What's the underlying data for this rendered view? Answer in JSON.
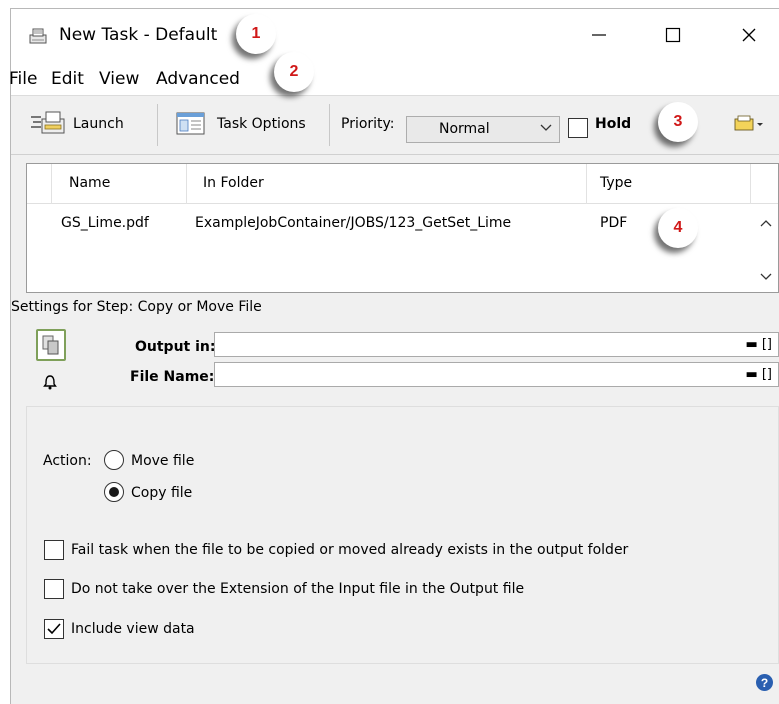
{
  "window": {
    "title": "New Task - Default",
    "minimize_glyph": "—",
    "maximize_glyph": "☐",
    "close_glyph": "✕"
  },
  "callouts": [
    "1",
    "2",
    "3",
    "4"
  ],
  "menu": [
    "File",
    "Edit",
    "View",
    "Advanced"
  ],
  "toolbar": {
    "launch_label": "Launch",
    "task_options_label": "Task Options",
    "priority_label": "Priority:",
    "priority_value": "Normal",
    "hold_label": "Hold",
    "hold_checked": false
  },
  "file_list": {
    "columns": [
      "Name",
      "In Folder",
      "Type"
    ],
    "rows": [
      {
        "name": "GS_Lime.pdf",
        "folder": "ExampleJobContainer/JOBS/123_GetSet_Lime",
        "type": "PDF"
      }
    ]
  },
  "settings": {
    "title": "Settings for Step: Copy or Move File",
    "output_in_label": "Output in:",
    "output_in_value": "",
    "file_name_label": "File Name:",
    "file_name_value": "",
    "field_btn_folder": "▬",
    "field_btn_brackets": "[]"
  },
  "panel": {
    "action_label": "Action:",
    "move_label": "Move file",
    "copy_label": "Copy file",
    "selected_action": "copy",
    "fail_label": "Fail task when the file to be copied or moved already exists in the output folder",
    "fail_checked": false,
    "extension_label": "Do not take over the Extension of the Input file in the Output file",
    "extension_checked": false,
    "include_view_label": "Include view data",
    "include_view_checked": true
  },
  "help_glyph": "?",
  "colors": {
    "callout_number": "#d01818",
    "step_icon_border": "#7fa05a",
    "help_icon": "#2a5fb0"
  }
}
